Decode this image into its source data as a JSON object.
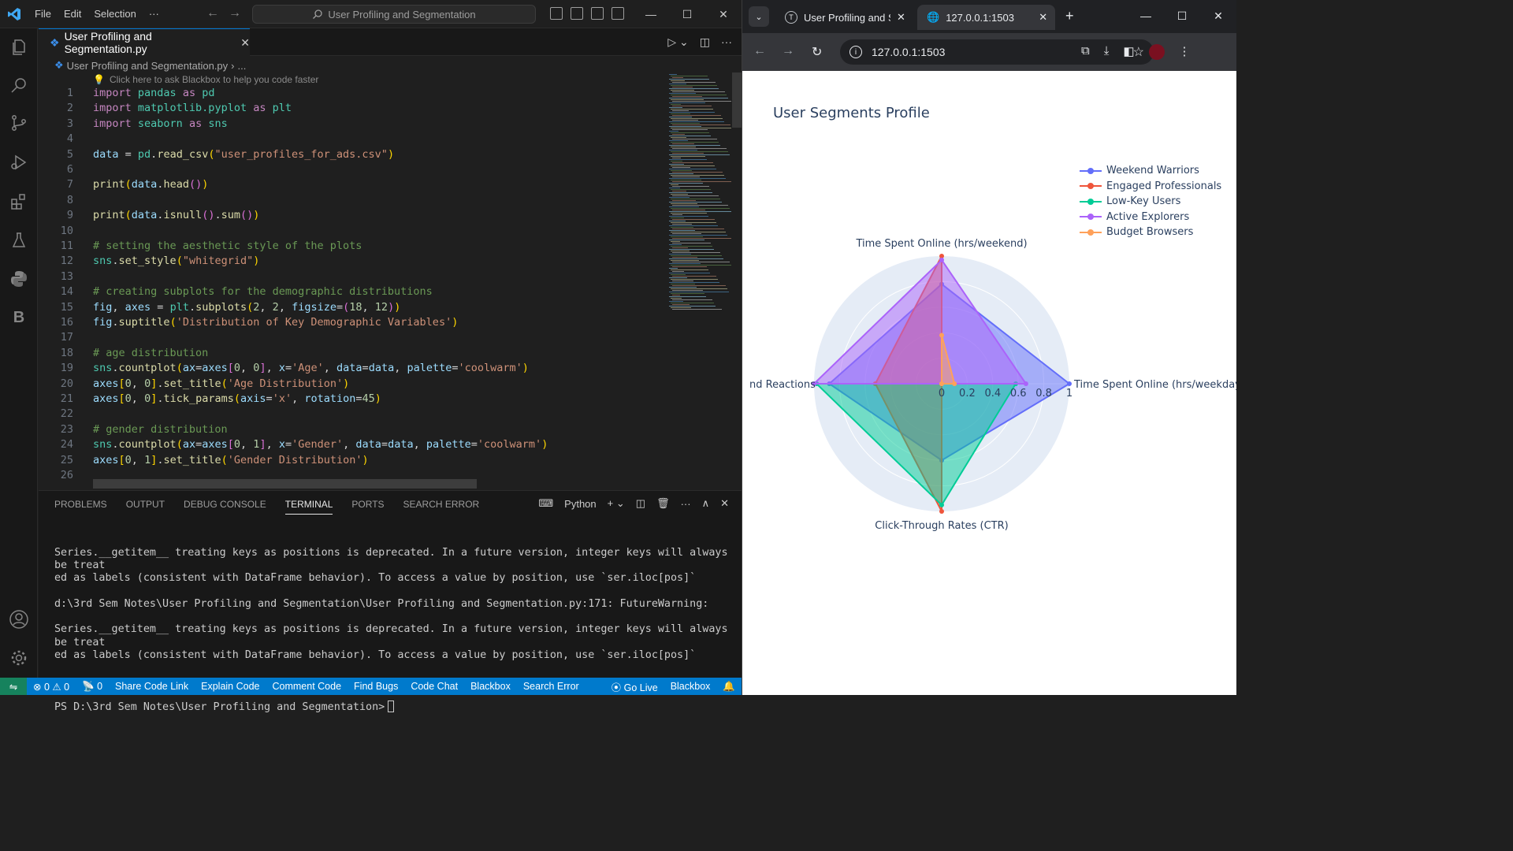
{
  "vscode": {
    "menu": [
      "File",
      "Edit",
      "Selection",
      "···"
    ],
    "search_placeholder": "User Profiling and Segmentation",
    "tab_title": "User Profiling and Segmentation.py",
    "breadcrumb": "User Profiling and Segmentation.py",
    "breadcrumb_more": "...",
    "hint": "Click here to ask Blackbox to help you code faster",
    "code_lines": [
      {
        "n": "1",
        "segs": [
          [
            "kw2",
            "import "
          ],
          [
            "mod",
            "pandas"
          ],
          [
            "kw2",
            " as "
          ],
          [
            "mod",
            "pd"
          ]
        ]
      },
      {
        "n": "2",
        "segs": [
          [
            "kw2",
            "import "
          ],
          [
            "mod",
            "matplotlib.pyplot"
          ],
          [
            "kw2",
            " as "
          ],
          [
            "mod",
            "plt"
          ]
        ]
      },
      {
        "n": "3",
        "segs": [
          [
            "kw2",
            "import "
          ],
          [
            "mod",
            "seaborn"
          ],
          [
            "kw2",
            " as "
          ],
          [
            "mod",
            "sns"
          ]
        ]
      },
      {
        "n": "4",
        "segs": []
      },
      {
        "n": "5",
        "segs": [
          [
            "var",
            "data"
          ],
          [
            "plain",
            " = "
          ],
          [
            "mod",
            "pd"
          ],
          [
            "plain",
            "."
          ],
          [
            "fn",
            "read_csv"
          ],
          [
            "p1",
            "("
          ],
          [
            "str",
            "\"user_profiles_for_ads.csv\""
          ],
          [
            "p1",
            ")"
          ]
        ]
      },
      {
        "n": "6",
        "segs": []
      },
      {
        "n": "7",
        "segs": [
          [
            "fn",
            "print"
          ],
          [
            "p1",
            "("
          ],
          [
            "var",
            "data"
          ],
          [
            "plain",
            "."
          ],
          [
            "fn",
            "head"
          ],
          [
            "p2",
            "()"
          ],
          [
            "p1",
            ")"
          ]
        ]
      },
      {
        "n": "8",
        "segs": []
      },
      {
        "n": "9",
        "segs": [
          [
            "fn",
            "print"
          ],
          [
            "p1",
            "("
          ],
          [
            "var",
            "data"
          ],
          [
            "plain",
            "."
          ],
          [
            "fn",
            "isnull"
          ],
          [
            "p2",
            "()"
          ],
          [
            "plain",
            "."
          ],
          [
            "fn",
            "sum"
          ],
          [
            "p2",
            "()"
          ],
          [
            "p1",
            ")"
          ]
        ]
      },
      {
        "n": "10",
        "segs": []
      },
      {
        "n": "11",
        "segs": [
          [
            "cmt",
            "# setting the aesthetic style of the plots"
          ]
        ]
      },
      {
        "n": "12",
        "segs": [
          [
            "mod",
            "sns"
          ],
          [
            "plain",
            "."
          ],
          [
            "fn",
            "set_style"
          ],
          [
            "p1",
            "("
          ],
          [
            "str",
            "\"whitegrid\""
          ],
          [
            "p1",
            ")"
          ]
        ]
      },
      {
        "n": "13",
        "segs": []
      },
      {
        "n": "14",
        "segs": [
          [
            "cmt",
            "# creating subplots for the demographic distributions"
          ]
        ]
      },
      {
        "n": "15",
        "segs": [
          [
            "var",
            "fig"
          ],
          [
            "plain",
            ", "
          ],
          [
            "var",
            "axes"
          ],
          [
            "plain",
            " = "
          ],
          [
            "mod",
            "plt"
          ],
          [
            "plain",
            "."
          ],
          [
            "fn",
            "subplots"
          ],
          [
            "p1",
            "("
          ],
          [
            "num",
            "2"
          ],
          [
            "plain",
            ", "
          ],
          [
            "num",
            "2"
          ],
          [
            "plain",
            ", "
          ],
          [
            "var",
            "figsize"
          ],
          [
            "plain",
            "="
          ],
          [
            "p2",
            "("
          ],
          [
            "num",
            "18"
          ],
          [
            "plain",
            ", "
          ],
          [
            "num",
            "12"
          ],
          [
            "p2",
            ")"
          ],
          [
            "p1",
            ")"
          ]
        ]
      },
      {
        "n": "16",
        "segs": [
          [
            "var",
            "fig"
          ],
          [
            "plain",
            "."
          ],
          [
            "fn",
            "suptitle"
          ],
          [
            "p1",
            "("
          ],
          [
            "str",
            "'Distribution of Key Demographic Variables'"
          ],
          [
            "p1",
            ")"
          ]
        ]
      },
      {
        "n": "17",
        "segs": []
      },
      {
        "n": "18",
        "segs": [
          [
            "cmt",
            "# age distribution"
          ]
        ]
      },
      {
        "n": "19",
        "segs": [
          [
            "mod",
            "sns"
          ],
          [
            "plain",
            "."
          ],
          [
            "fn",
            "countplot"
          ],
          [
            "p1",
            "("
          ],
          [
            "var",
            "ax"
          ],
          [
            "plain",
            "="
          ],
          [
            "var",
            "axes"
          ],
          [
            "p2",
            "["
          ],
          [
            "num",
            "0"
          ],
          [
            "plain",
            ", "
          ],
          [
            "num",
            "0"
          ],
          [
            "p2",
            "]"
          ],
          [
            "plain",
            ", "
          ],
          [
            "var",
            "x"
          ],
          [
            "plain",
            "="
          ],
          [
            "str",
            "'Age'"
          ],
          [
            "plain",
            ", "
          ],
          [
            "var",
            "data"
          ],
          [
            "plain",
            "="
          ],
          [
            "var",
            "data"
          ],
          [
            "plain",
            ", "
          ],
          [
            "var",
            "palette"
          ],
          [
            "plain",
            "="
          ],
          [
            "str",
            "'coolwarm'"
          ],
          [
            "p1",
            ")"
          ]
        ]
      },
      {
        "n": "20",
        "segs": [
          [
            "var",
            "axes"
          ],
          [
            "p1",
            "["
          ],
          [
            "num",
            "0"
          ],
          [
            "plain",
            ", "
          ],
          [
            "num",
            "0"
          ],
          [
            "p1",
            "]"
          ],
          [
            "plain",
            "."
          ],
          [
            "fn",
            "set_title"
          ],
          [
            "p1",
            "("
          ],
          [
            "str",
            "'Age Distribution'"
          ],
          [
            "p1",
            ")"
          ]
        ]
      },
      {
        "n": "21",
        "segs": [
          [
            "var",
            "axes"
          ],
          [
            "p1",
            "["
          ],
          [
            "num",
            "0"
          ],
          [
            "plain",
            ", "
          ],
          [
            "num",
            "0"
          ],
          [
            "p1",
            "]"
          ],
          [
            "plain",
            "."
          ],
          [
            "fn",
            "tick_params"
          ],
          [
            "p1",
            "("
          ],
          [
            "var",
            "axis"
          ],
          [
            "plain",
            "="
          ],
          [
            "str",
            "'x'"
          ],
          [
            "plain",
            ", "
          ],
          [
            "var",
            "rotation"
          ],
          [
            "plain",
            "="
          ],
          [
            "num",
            "45"
          ],
          [
            "p1",
            ")"
          ]
        ]
      },
      {
        "n": "22",
        "segs": []
      },
      {
        "n": "23",
        "segs": [
          [
            "cmt",
            "# gender distribution"
          ]
        ]
      },
      {
        "n": "24",
        "segs": [
          [
            "mod",
            "sns"
          ],
          [
            "plain",
            "."
          ],
          [
            "fn",
            "countplot"
          ],
          [
            "p1",
            "("
          ],
          [
            "var",
            "ax"
          ],
          [
            "plain",
            "="
          ],
          [
            "var",
            "axes"
          ],
          [
            "p2",
            "["
          ],
          [
            "num",
            "0"
          ],
          [
            "plain",
            ", "
          ],
          [
            "num",
            "1"
          ],
          [
            "p2",
            "]"
          ],
          [
            "plain",
            ", "
          ],
          [
            "var",
            "x"
          ],
          [
            "plain",
            "="
          ],
          [
            "str",
            "'Gender'"
          ],
          [
            "plain",
            ", "
          ],
          [
            "var",
            "data"
          ],
          [
            "plain",
            "="
          ],
          [
            "var",
            "data"
          ],
          [
            "plain",
            ", "
          ],
          [
            "var",
            "palette"
          ],
          [
            "plain",
            "="
          ],
          [
            "str",
            "'coolwarm'"
          ],
          [
            "p1",
            ")"
          ]
        ]
      },
      {
        "n": "25",
        "segs": [
          [
            "var",
            "axes"
          ],
          [
            "p1",
            "["
          ],
          [
            "num",
            "0"
          ],
          [
            "plain",
            ", "
          ],
          [
            "num",
            "1"
          ],
          [
            "p1",
            "]"
          ],
          [
            "plain",
            "."
          ],
          [
            "fn",
            "set_title"
          ],
          [
            "p1",
            "("
          ],
          [
            "str",
            "'Gender Distribution'"
          ],
          [
            "p1",
            ")"
          ]
        ]
      },
      {
        "n": "26",
        "segs": []
      }
    ],
    "panel_tabs": [
      "PROBLEMS",
      "OUTPUT",
      "DEBUG CONSOLE",
      "TERMINAL",
      "PORTS",
      "SEARCH ERROR"
    ],
    "terminal_shell": "Python",
    "terminal_lines": [
      "Series.__getitem__ treating keys as positions is deprecated. In a future version, integer keys will always be treat",
      "ed as labels (consistent with DataFrame behavior). To access a value by position, use `ser.iloc[pos]`",
      "",
      "d:\\3rd Sem Notes\\User Profiling and Segmentation\\User Profiling and Segmentation.py:171: FutureWarning:",
      "",
      "Series.__getitem__ treating keys as positions is deprecated. In a future version, integer keys will always be treat",
      "ed as labels (consistent with DataFrame behavior). To access a value by position, use `ser.iloc[pos]`",
      ""
    ],
    "prompt": "PS D:\\3rd Sem Notes\\User Profiling and Segmentation>",
    "status": {
      "errors": "0",
      "warnings": "0",
      "ports": "0",
      "items": [
        "Share Code Link",
        "Explain Code",
        "Comment Code",
        "Find Bugs",
        "Code Chat",
        "Blackbox",
        "Search Error"
      ],
      "go_live": "Go Live",
      "blackbox_right": "Blackbox"
    }
  },
  "browser": {
    "tab1_title": "User Profiling and Se",
    "tab2_title": "127.0.0.1:1503",
    "url": "127.0.0.1:1503"
  },
  "chart_data": {
    "type": "radar",
    "title": "User Segments Profile",
    "axes": [
      "Time Spent Online (hrs/weekday)",
      "Time Spent Online (hrs/weekend)",
      "nd Reactions",
      "Click-Through Rates (CTR)"
    ],
    "radial_ticks": [
      "0",
      "0.2",
      "0.4",
      "0.6",
      "0.8",
      "1"
    ],
    "radial_range": [
      0,
      1
    ],
    "legend_position": "top-right",
    "series": [
      {
        "name": "Weekend Warriors",
        "color": "#636efa",
        "values": [
          1.0,
          0.78,
          0.88,
          0.6
        ]
      },
      {
        "name": "Engaged Professionals",
        "color": "#ef553b",
        "values": [
          0.0,
          1.0,
          0.52,
          1.0
        ]
      },
      {
        "name": "Low-Key Users",
        "color": "#00cc96",
        "values": [
          0.58,
          0.0,
          0.98,
          0.95
        ]
      },
      {
        "name": "Active Explorers",
        "color": "#ab63fa",
        "values": [
          0.66,
          0.97,
          1.0,
          0.0
        ]
      },
      {
        "name": "Budget Browsers",
        "color": "#ffa15a",
        "values": [
          0.1,
          0.38,
          0.0,
          0.0
        ]
      }
    ]
  }
}
